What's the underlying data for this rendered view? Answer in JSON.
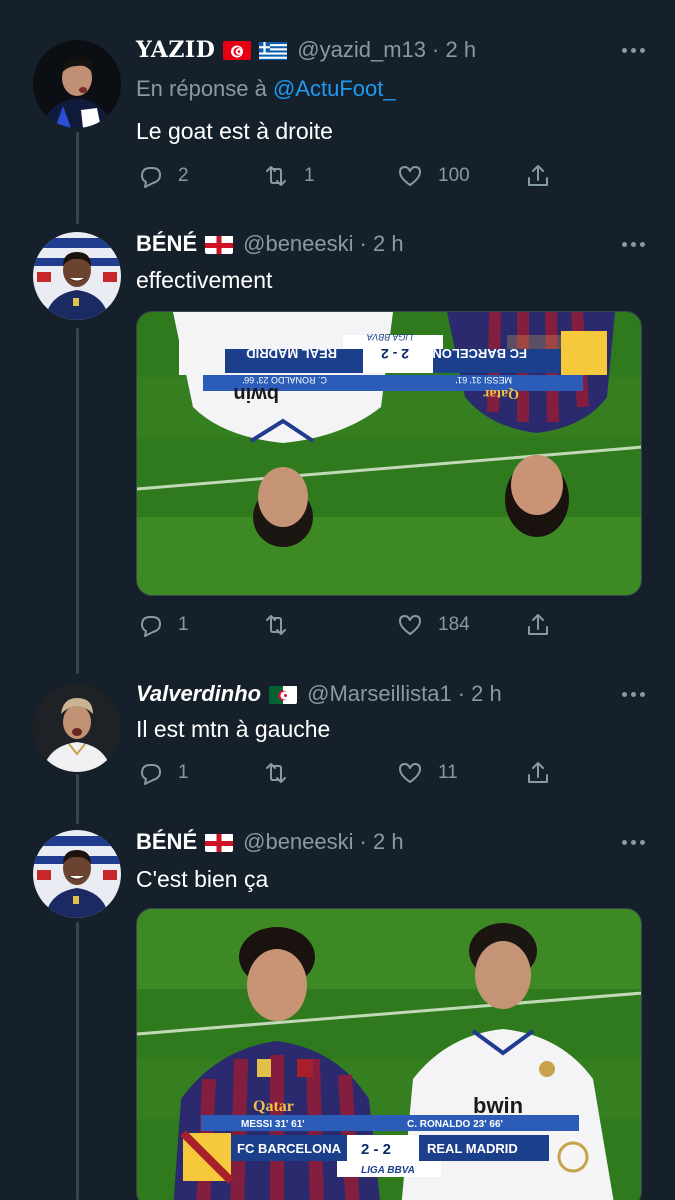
{
  "tweets": [
    {
      "name": "YAZID",
      "handle": "@yazid_m13",
      "time": "· 2 h",
      "reply_prefix": "En réponse à",
      "reply_handle": "@ActuFoot_",
      "text": "Le goat est à droite",
      "replies": "2",
      "retweets": "1",
      "likes": "100",
      "flags": [
        "tunisia",
        "greece"
      ]
    },
    {
      "name": "BÉNÉ",
      "handle": "@beneeski",
      "time": "· 2 h",
      "text": "effectivement",
      "replies": "1",
      "retweets": "",
      "likes": "184",
      "flags": [
        "england"
      ],
      "media": {
        "orientation": "upside-down",
        "score_left_team": "FC BARCELONA",
        "score": "2 - 2",
        "score_right_team": "REAL MADRID",
        "scorer_left": "MESSI 31' 61'",
        "scorer_right": "C. RONALDO 23' 66'",
        "league": "LIGA BBVA",
        "sponsor_left": "Qatar",
        "sponsor_right": "bwin"
      }
    },
    {
      "name": "Valverdinho",
      "handle": "@Marseillista1",
      "time": "· 2 h",
      "text": "Il est mtn à gauche",
      "replies": "1",
      "retweets": "",
      "likes": "11",
      "flags": [
        "algeria"
      ]
    },
    {
      "name": "BÉNÉ",
      "handle": "@beneeski",
      "time": "· 2 h",
      "text": "C'est bien ça",
      "flags": [
        "england"
      ],
      "media": {
        "orientation": "normal",
        "score_left_team": "FC BARCELONA",
        "score": "2 - 2",
        "score_right_team": "REAL MADRID",
        "scorer_left": "MESSI 31' 61'",
        "scorer_right": "C. RONALDO 23' 66'",
        "league": "LIGA BBVA",
        "sponsor_left": "Qatar",
        "sponsor_right": "bwin"
      }
    }
  ],
  "icons": {
    "reply": "reply-icon",
    "retweet": "retweet-icon",
    "like": "heart-icon",
    "share": "share-icon",
    "more": "more-icon"
  },
  "colors": {
    "background": "#15202b",
    "secondary_text": "#8899a6",
    "link": "#1d9bf0",
    "thread_line": "#38444d"
  }
}
